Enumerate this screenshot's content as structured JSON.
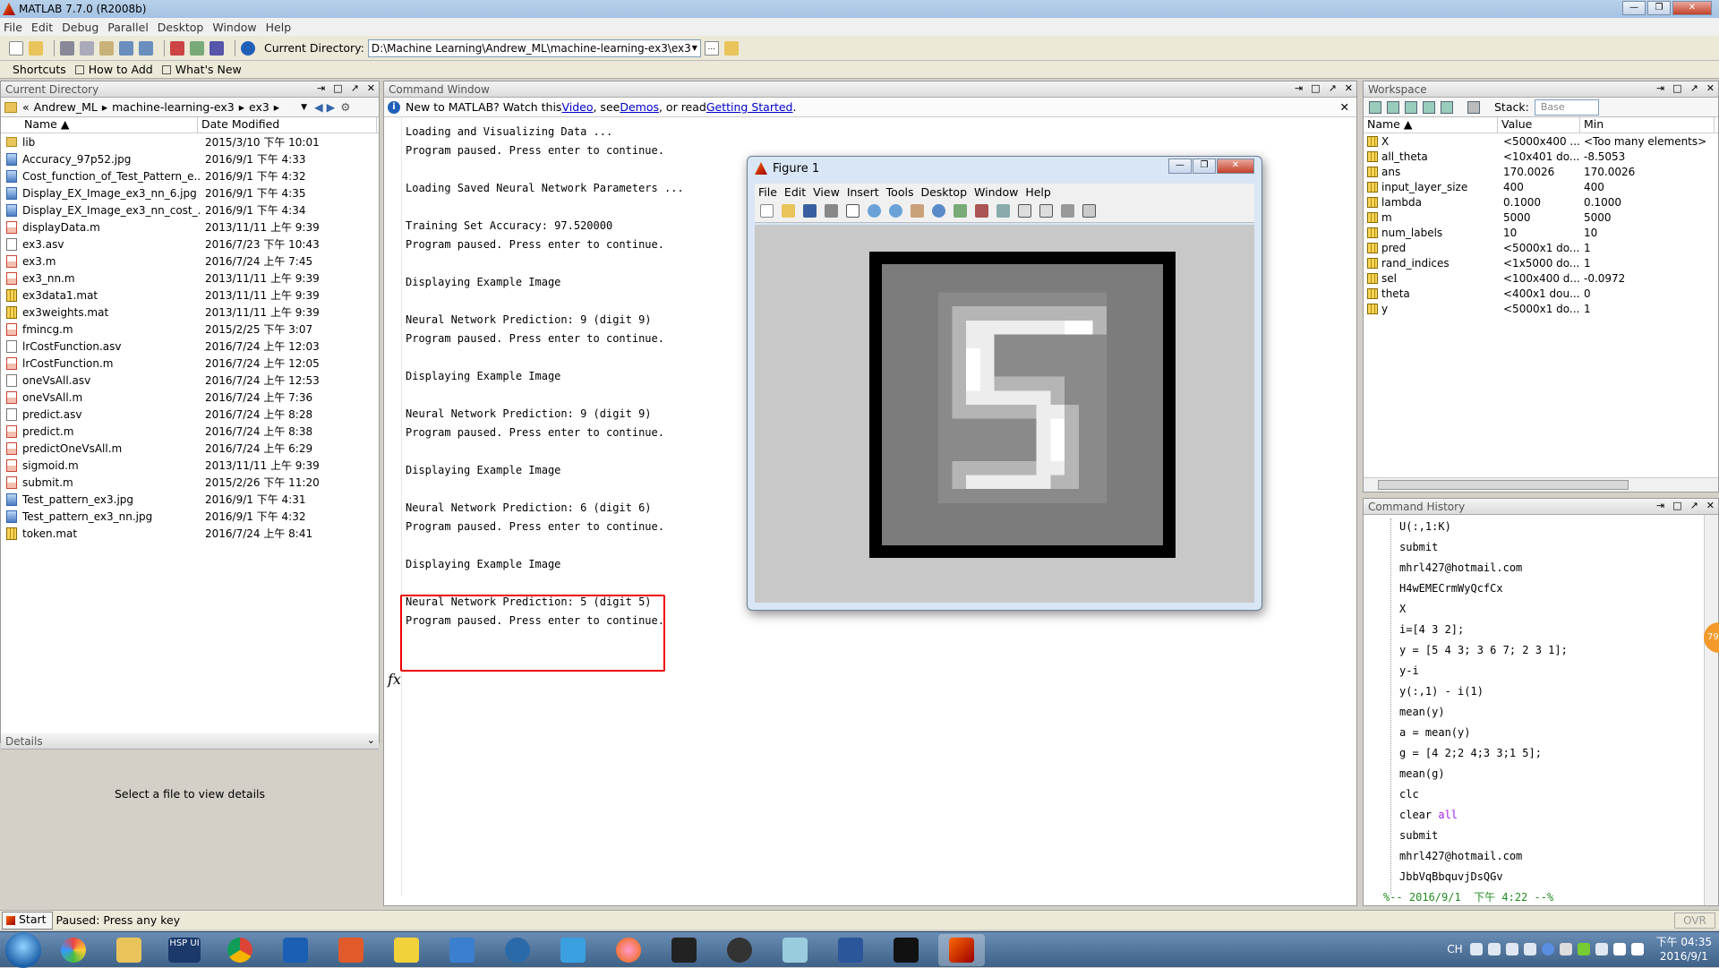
{
  "window": {
    "title": "MATLAB  7.7.0 (R2008b)"
  },
  "menu": [
    "File",
    "Edit",
    "Debug",
    "Parallel",
    "Desktop",
    "Window",
    "Help"
  ],
  "toolbar": {
    "current_dir_label": "Current Directory:",
    "current_dir_value": "D:\\Machine Learning\\Andrew_ML\\machine-learning-ex3\\ex3",
    "browse": "..."
  },
  "shortcuts": {
    "label": "Shortcuts",
    "how_to_add": "How to Add",
    "whats_new": "What's New"
  },
  "current_directory": {
    "title": "Current Directory",
    "breadcrumb": [
      "«",
      "Andrew_ML",
      "▸",
      "machine-learning-ex3",
      "▸",
      "ex3",
      "▸"
    ],
    "col_name": "Name ▲",
    "col_date": "Date Modified",
    "files": [
      {
        "name": "lib",
        "date": "2015/3/10 下午 10:01",
        "icon": "folder"
      },
      {
        "name": "Accuracy_97p52.jpg",
        "date": "2016/9/1 下午 4:33",
        "icon": "image"
      },
      {
        "name": "Cost_function_of_Test_Pattern_e...",
        "date": "2016/9/1 下午 4:32",
        "icon": "image"
      },
      {
        "name": "Display_EX_Image_ex3_nn_6.jpg",
        "date": "2016/9/1 下午 4:35",
        "icon": "image"
      },
      {
        "name": "Display_EX_Image_ex3_nn_cost_...",
        "date": "2016/9/1 下午 4:34",
        "icon": "image"
      },
      {
        "name": "displayData.m",
        "date": "2013/11/11 上午 9:39",
        "icon": "m-file"
      },
      {
        "name": "ex3.asv",
        "date": "2016/7/23 下午 10:43",
        "icon": "file"
      },
      {
        "name": "ex3.m",
        "date": "2016/7/24 上午 7:45",
        "icon": "m-file"
      },
      {
        "name": "ex3_nn.m",
        "date": "2013/11/11 上午 9:39",
        "icon": "m-file"
      },
      {
        "name": "ex3data1.mat",
        "date": "2013/11/11 上午 9:39",
        "icon": "mat-file"
      },
      {
        "name": "ex3weights.mat",
        "date": "2013/11/11 上午 9:39",
        "icon": "mat-file"
      },
      {
        "name": "fmincg.m",
        "date": "2015/2/25 下午 3:07",
        "icon": "m-file"
      },
      {
        "name": "lrCostFunction.asv",
        "date": "2016/7/24 上午 12:03",
        "icon": "file"
      },
      {
        "name": "lrCostFunction.m",
        "date": "2016/7/24 上午 12:05",
        "icon": "m-file"
      },
      {
        "name": "oneVsAll.asv",
        "date": "2016/7/24 上午 12:53",
        "icon": "file"
      },
      {
        "name": "oneVsAll.m",
        "date": "2016/7/24 上午 7:36",
        "icon": "m-file"
      },
      {
        "name": "predict.asv",
        "date": "2016/7/24 上午 8:28",
        "icon": "file"
      },
      {
        "name": "predict.m",
        "date": "2016/7/24 上午 8:38",
        "icon": "m-file"
      },
      {
        "name": "predictOneVsAll.m",
        "date": "2016/7/24 上午 6:29",
        "icon": "m-file"
      },
      {
        "name": "sigmoid.m",
        "date": "2013/11/11 上午 9:39",
        "icon": "m-file"
      },
      {
        "name": "submit.m",
        "date": "2015/2/26 下午 11:20",
        "icon": "m-file"
      },
      {
        "name": "Test_pattern_ex3.jpg",
        "date": "2016/9/1 下午 4:31",
        "icon": "image"
      },
      {
        "name": "Test_pattern_ex3_nn.jpg",
        "date": "2016/9/1 下午 4:32",
        "icon": "image"
      },
      {
        "name": "token.mat",
        "date": "2016/7/24 上午 8:41",
        "icon": "mat-file"
      }
    ],
    "details_title": "Details",
    "details_text": "Select a file to view details"
  },
  "command_window": {
    "title": "Command Window",
    "info_prefix": "New to MATLAB? Watch this ",
    "info_video": "Video",
    "info_mid": ", see ",
    "info_demos": "Demos",
    "info_mid2": ", or read ",
    "info_started": "Getting Started",
    "info_end": ".",
    "lines": [
      "Loading and Visualizing Data ...",
      "Program paused. Press enter to continue.",
      "",
      "Loading Saved Neural Network Parameters ...",
      "",
      "Training Set Accuracy: 97.520000",
      "Program paused. Press enter to continue.",
      "",
      "Displaying Example Image",
      "",
      "Neural Network Prediction: 9 (digit 9)",
      "Program paused. Press enter to continue.",
      "",
      "Displaying Example Image",
      "",
      "Neural Network Prediction: 9 (digit 9)",
      "Program paused. Press enter to continue.",
      "",
      "Displaying Example Image",
      "",
      "Neural Network Prediction: 6 (digit 6)",
      "Program paused. Press enter to continue.",
      "",
      "Displaying Example Image",
      "",
      "Neural Network Prediction: 5 (digit 5)",
      "Program paused. Press enter to continue."
    ],
    "prompt": "fx"
  },
  "figure": {
    "title": "Figure 1",
    "menu": [
      "File",
      "Edit",
      "View",
      "Insert",
      "Tools",
      "Desktop",
      "Window",
      "Help"
    ]
  },
  "workspace": {
    "title": "Workspace",
    "stack_label": "Stack:",
    "stack_value": "Base",
    "col_name": "Name ▲",
    "col_value": "Value",
    "col_min": "Min",
    "vars": [
      {
        "name": "X",
        "value": "<5000x400 ...",
        "min": "<Too many elements>"
      },
      {
        "name": "all_theta",
        "value": "<10x401 do...",
        "min": "-8.5053"
      },
      {
        "name": "ans",
        "value": "170.0026",
        "min": "170.0026"
      },
      {
        "name": "input_layer_size",
        "value": "400",
        "min": "400"
      },
      {
        "name": "lambda",
        "value": "0.1000",
        "min": "0.1000"
      },
      {
        "name": "m",
        "value": "5000",
        "min": "5000"
      },
      {
        "name": "num_labels",
        "value": "10",
        "min": "10"
      },
      {
        "name": "pred",
        "value": "<5000x1 do...",
        "min": "1"
      },
      {
        "name": "rand_indices",
        "value": "<1x5000 do...",
        "min": "1"
      },
      {
        "name": "sel",
        "value": "<100x400 d...",
        "min": "-0.0972"
      },
      {
        "name": "theta",
        "value": "<400x1 dou...",
        "min": "0"
      },
      {
        "name": "y",
        "value": "<5000x1 do...",
        "min": "1"
      }
    ]
  },
  "command_history": {
    "title": "Command History",
    "lines": [
      "U(:,1:K)",
      "submit",
      "mhrl427@hotmail.com",
      "H4wEMECrmWyQcfCx",
      "X",
      "i=[4 3 2];",
      "y = [5 4 3; 3 6 7; 2 3 1];",
      "y-i",
      "y(:,1) - i(1)",
      "mean(y)",
      "a = mean(y)",
      "g = [4 2;2 4;3 3;1 5];",
      "mean(g)",
      "clc",
      "clear all",
      "submit",
      "mhrl427@hotmail.com",
      "JbbVqBbquvjDsQGv"
    ],
    "session": "%-- 2016/9/1  下午 4:22 --%"
  },
  "status": {
    "start": "Start",
    "text": "Paused: Press any key",
    "ovr": "OVR"
  },
  "taskbar": {
    "hsp": "HSP UI",
    "lang": "CH",
    "time": "下午 04:35",
    "date": "2016/9/1",
    "badge": "79"
  }
}
